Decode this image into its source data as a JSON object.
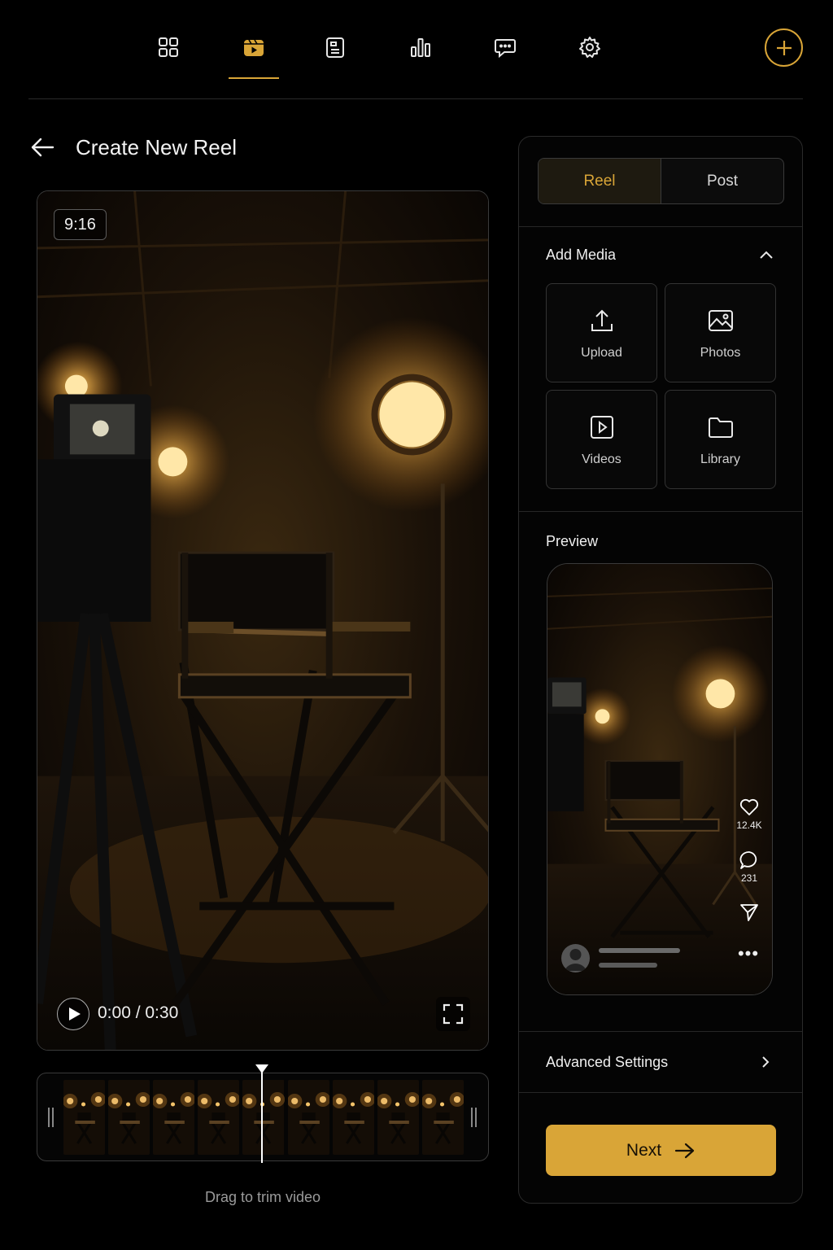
{
  "nav": {
    "items": [
      {
        "icon": "grid-icon",
        "active": false
      },
      {
        "icon": "clapperboard-play-icon",
        "active": true
      },
      {
        "icon": "document-icon",
        "active": false
      },
      {
        "icon": "bar-chart-icon",
        "active": false
      },
      {
        "icon": "chat-bubble-icon",
        "active": false
      },
      {
        "icon": "gear-icon",
        "active": false
      }
    ],
    "create_icon": "plus-circle-icon"
  },
  "header": {
    "back_icon": "arrow-left-icon",
    "title": "Create New Reel"
  },
  "video": {
    "aspect_ratio": "9:16",
    "time": "0:00 / 0:30",
    "play_icon": "play-icon",
    "fullscreen_icon": "fullscreen-icon"
  },
  "timeline": {
    "frame_count": 9,
    "playhead_fraction": 0.5,
    "hint": "Drag to trim video"
  },
  "panel": {
    "tabs": [
      {
        "label": "Reel",
        "active": true
      },
      {
        "label": "Post",
        "active": false
      }
    ],
    "add_media": {
      "title": "Add Media",
      "items": [
        {
          "label": "Upload",
          "icon": "upload-icon"
        },
        {
          "label": "Photos",
          "icon": "image-icon"
        },
        {
          "label": "Videos",
          "icon": "video-play-icon"
        },
        {
          "label": "Library",
          "icon": "folder-icon"
        }
      ]
    },
    "preview": {
      "title": "Preview",
      "likes": "12.4K",
      "comments": "231"
    },
    "advanced_settings": "Advanced Settings",
    "next_label": "Next"
  },
  "colors": {
    "accent": "#d9a537",
    "background": "#000000",
    "border": "#2a2a2a"
  }
}
